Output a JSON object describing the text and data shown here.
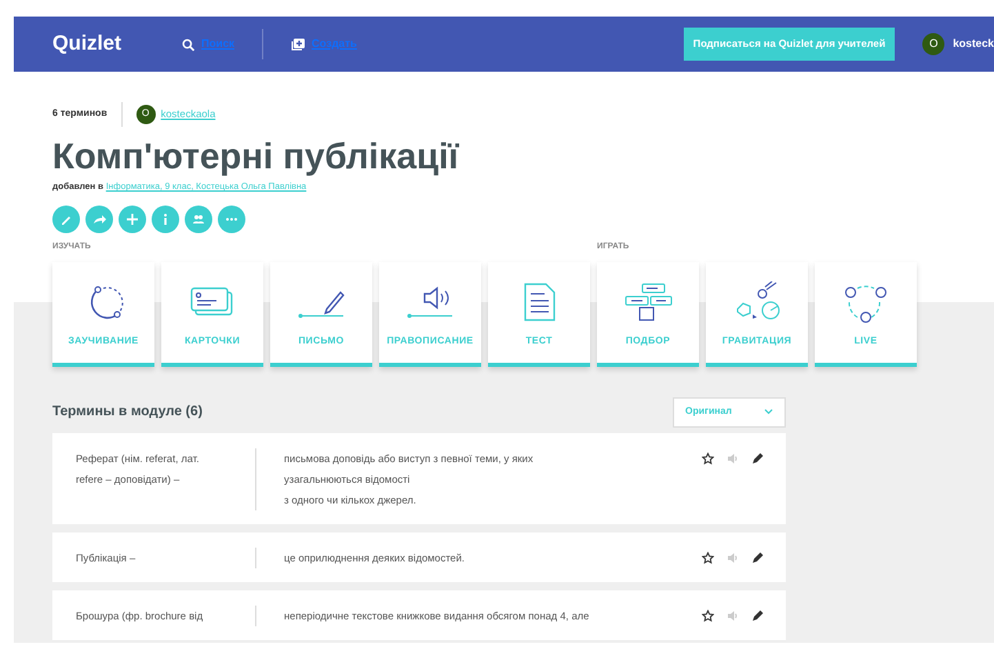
{
  "navbar": {
    "logo": "Quizlet",
    "search": "Поиск",
    "create": "Создать",
    "teacher_button": "Подписаться на Quizlet для учителей",
    "avatar_letter": "O",
    "username": "kosteck"
  },
  "set": {
    "term_count": "6 терминов",
    "author_avatar_letter": "O",
    "author": "kosteckaola",
    "title": "Комп'ютерні публікації",
    "added_label": "добавлен в",
    "added_link": "Інформатика, 9 клас, Костецька Ольга Павлівна"
  },
  "modes": [
    {
      "group": "ИЗУЧАТЬ",
      "items": [
        {
          "label": "ЗАУЧИВАНИЕ",
          "kind": "learn"
        },
        {
          "label": "КАРТОЧКИ",
          "kind": "cards"
        },
        {
          "label": "ПИСЬМО",
          "kind": "write"
        },
        {
          "label": "ПРАВОПИСАНИЕ",
          "kind": "spell"
        },
        {
          "label": "ТЕСТ",
          "kind": "test"
        }
      ]
    },
    {
      "group": "ИГРАТЬ",
      "items": [
        {
          "label": "ПОДБОР",
          "kind": "match"
        },
        {
          "label": "ГРАВИТАЦИЯ",
          "kind": "gravity"
        },
        {
          "label": "LIVE",
          "kind": "live"
        }
      ]
    }
  ],
  "terms": {
    "heading": "Термины в модуле (6)",
    "sort": "Оригинал",
    "rows": [
      {
        "term": [
          "Реферат (нім. referat, лат.",
          "refere – доповідати) –"
        ],
        "definition": [
          "письмова доповідь або виступ з певної теми, у яких",
          "узагальнюються відомості",
          "з одного чи кількох джерел."
        ]
      },
      {
        "term": [
          "Публікація –"
        ],
        "definition": [
          "це оприлюднення деяких відомостей."
        ]
      },
      {
        "term": [
          "Брошура (фр. brochure від"
        ],
        "definition": [
          "неперіодичне текстове книжкове видання обсягом понад 4, але"
        ]
      }
    ]
  }
}
